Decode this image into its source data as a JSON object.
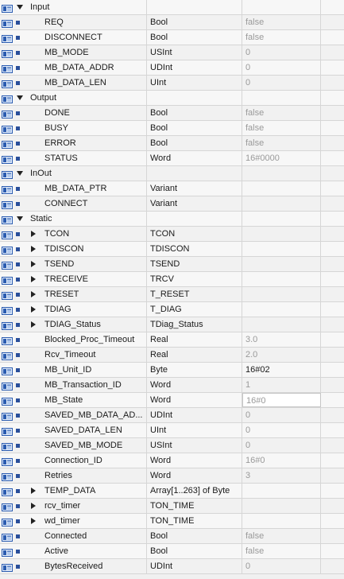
{
  "rows": [
    {
      "kind": "section",
      "name": "Input"
    },
    {
      "kind": "var",
      "name": "REQ",
      "type": "Bool",
      "value": "false"
    },
    {
      "kind": "var",
      "name": "DISCONNECT",
      "type": "Bool",
      "value": "false"
    },
    {
      "kind": "var",
      "name": "MB_MODE",
      "type": "USInt",
      "value": "0"
    },
    {
      "kind": "var",
      "name": "MB_DATA_ADDR",
      "type": "UDInt",
      "value": "0"
    },
    {
      "kind": "var",
      "name": "MB_DATA_LEN",
      "type": "UInt",
      "value": "0"
    },
    {
      "kind": "section",
      "name": "Output"
    },
    {
      "kind": "var",
      "name": "DONE",
      "type": "Bool",
      "value": "false"
    },
    {
      "kind": "var",
      "name": "BUSY",
      "type": "Bool",
      "value": "false"
    },
    {
      "kind": "var",
      "name": "ERROR",
      "type": "Bool",
      "value": "false"
    },
    {
      "kind": "var",
      "name": "STATUS",
      "type": "Word",
      "value": "16#0000"
    },
    {
      "kind": "section",
      "name": "InOut"
    },
    {
      "kind": "var",
      "name": "MB_DATA_PTR",
      "type": "Variant",
      "value": ""
    },
    {
      "kind": "var",
      "name": "CONNECT",
      "type": "Variant",
      "value": ""
    },
    {
      "kind": "section",
      "name": "Static"
    },
    {
      "kind": "struct",
      "name": "TCON",
      "type": "TCON",
      "value": ""
    },
    {
      "kind": "struct",
      "name": "TDISCON",
      "type": "TDISCON",
      "value": ""
    },
    {
      "kind": "struct",
      "name": "TSEND",
      "type": "TSEND",
      "value": ""
    },
    {
      "kind": "struct",
      "name": "TRECEIVE",
      "type": "TRCV",
      "value": ""
    },
    {
      "kind": "struct",
      "name": "TRESET",
      "type": "T_RESET",
      "value": ""
    },
    {
      "kind": "struct",
      "name": "TDIAG",
      "type": "T_DIAG",
      "value": ""
    },
    {
      "kind": "struct",
      "name": "TDIAG_Status",
      "type": "TDiag_Status",
      "value": ""
    },
    {
      "kind": "var",
      "name": "Blocked_Proc_Timeout",
      "type": "Real",
      "value": "3.0"
    },
    {
      "kind": "var",
      "name": "Rcv_Timeout",
      "type": "Real",
      "value": "2.0"
    },
    {
      "kind": "var",
      "name": "MB_Unit_ID",
      "type": "Byte",
      "value": "16#02",
      "dark": true
    },
    {
      "kind": "var",
      "name": "MB_Transaction_ID",
      "type": "Word",
      "value": "1"
    },
    {
      "kind": "var",
      "name": "MB_State",
      "type": "Word",
      "value": "16#0",
      "boxed": true
    },
    {
      "kind": "var",
      "name": "SAVED_MB_DATA_AD...",
      "type": "UDInt",
      "value": "0"
    },
    {
      "kind": "var",
      "name": "SAVED_DATA_LEN",
      "type": "UInt",
      "value": "0"
    },
    {
      "kind": "var",
      "name": "SAVED_MB_MODE",
      "type": "USInt",
      "value": "0"
    },
    {
      "kind": "var",
      "name": "Connection_ID",
      "type": "Word",
      "value": "16#0"
    },
    {
      "kind": "var",
      "name": "Retries",
      "type": "Word",
      "value": "3"
    },
    {
      "kind": "struct",
      "name": "TEMP_DATA",
      "type": "Array[1..263] of Byte",
      "value": ""
    },
    {
      "kind": "struct",
      "name": "rcv_timer",
      "type": "TON_TIME",
      "value": ""
    },
    {
      "kind": "struct",
      "name": "wd_timer",
      "type": "TON_TIME",
      "value": ""
    },
    {
      "kind": "var",
      "name": "Connected",
      "type": "Bool",
      "value": "false"
    },
    {
      "kind": "var",
      "name": "Active",
      "type": "Bool",
      "value": "false"
    },
    {
      "kind": "var",
      "name": "BytesReceived",
      "type": "UDInt",
      "value": "0"
    }
  ],
  "icon": "interface-variable-icon",
  "colors": {
    "icon_blue": "#2a5bb0",
    "icon_light": "#8fb2e6",
    "value_gray": "#9a9a9a"
  }
}
